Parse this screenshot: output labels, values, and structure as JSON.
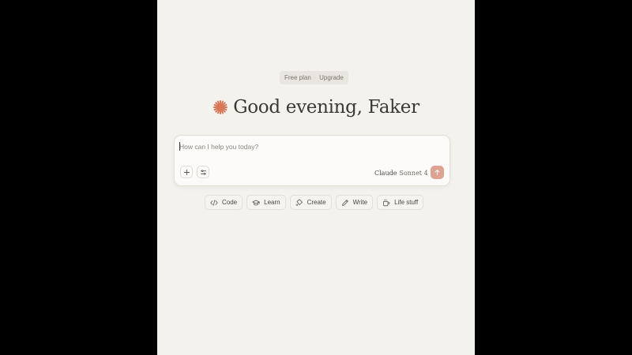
{
  "plan_badge": {
    "plan_label": "Free plan",
    "separator": "·",
    "upgrade_label": "Upgrade"
  },
  "greeting": {
    "text": "Good evening, Faker",
    "icon": "claude-burst-icon",
    "icon_color": "#d97757"
  },
  "composer": {
    "placeholder": "How can I help you today?",
    "value": "",
    "attach_icon": "plus-icon",
    "tools_icon": "sliders-icon",
    "model": {
      "brand": "Claude",
      "version": "Sonnet 4",
      "icon": "chevron-down-icon"
    },
    "send_icon": "arrow-up-icon",
    "send_color": "#dda290"
  },
  "chips": [
    {
      "label": "Code",
      "icon": "code-icon"
    },
    {
      "label": "Learn",
      "icon": "graduation-cap-icon"
    },
    {
      "label": "Create",
      "icon": "paint-bucket-icon"
    },
    {
      "label": "Write",
      "icon": "pencil-icon"
    },
    {
      "label": "Life stuff",
      "icon": "coffee-cup-icon"
    }
  ],
  "colors": {
    "background": "#f4f2ed",
    "outer_background": "#000000",
    "text": "#3b3935",
    "accent": "#d97757"
  }
}
